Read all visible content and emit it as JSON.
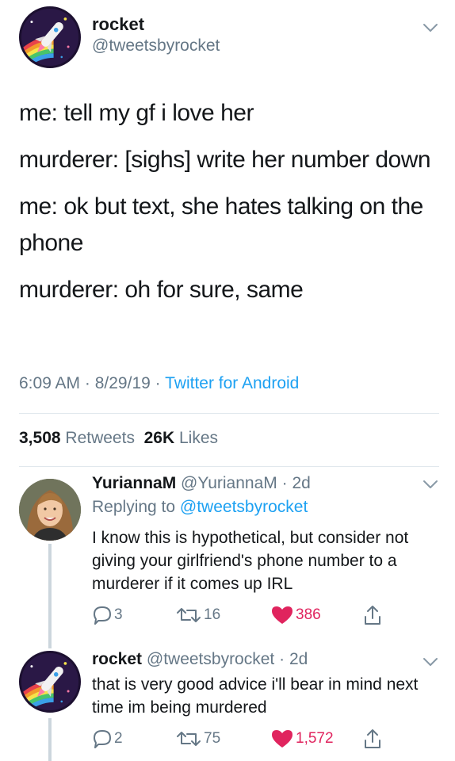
{
  "main_tweet": {
    "display_name": "rocket",
    "handle": "@tweetsbyrocket",
    "lines": [
      "me: tell my gf i love her",
      "murderer: [sighs] write her number down",
      "me: ok but text, she hates talking on the phone",
      "murderer: oh for sure, same"
    ],
    "time": "6:09 AM",
    "date": "8/29/19",
    "source": "Twitter for Android",
    "separator": " · ",
    "retweets_count": "3,508",
    "retweets_label": "Retweets",
    "likes_count": "26K",
    "likes_label": "Likes"
  },
  "replies": [
    {
      "display_name": "YuriannaM",
      "handle": "@YuriannaM",
      "time_ago": "2d",
      "replying_prefix": "Replying to",
      "replying_to": "@tweetsbyrocket",
      "text": "I know this is hypothetical, but consider not giving your girlfriend's phone number to a murderer if it comes up IRL",
      "replies": "3",
      "retweets": "16",
      "likes": "386"
    },
    {
      "display_name": "rocket",
      "handle": "@tweetsbyrocket",
      "time_ago": "2d",
      "text": "that is very good advice i'll bear in mind next time im being murdered",
      "replies": "2",
      "retweets": "75",
      "likes": "1,572"
    }
  ],
  "icons": {
    "more": "chevron-down-icon",
    "reply": "reply-icon",
    "retweet": "retweet-icon",
    "like": "heart-icon",
    "share": "share-icon"
  },
  "colors": {
    "link": "#1da1f2",
    "secondary_text": "#657786",
    "like": "#e0245e",
    "divider": "#e1e8ed"
  }
}
